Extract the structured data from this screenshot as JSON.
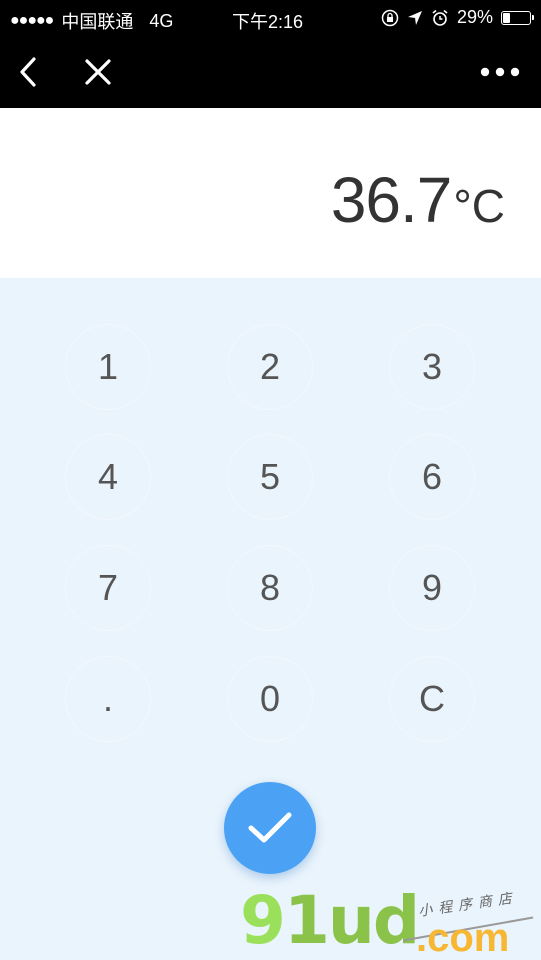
{
  "status_bar": {
    "signal_dots": "●●●●●",
    "carrier": "中国联通",
    "network": "4G",
    "time": "下午2:16",
    "battery_text": "29%",
    "battery_level": 0.29
  },
  "display": {
    "value": "36.7",
    "unit": "°C"
  },
  "keypad": {
    "keys": [
      "1",
      "2",
      "3",
      "4",
      "5",
      "6",
      "7",
      "8",
      "9",
      ".",
      "0",
      "C"
    ]
  },
  "watermark": {
    "brand_a": "9",
    "brand_b": "1ud",
    "domain": ".com",
    "tagline": "小程序商店"
  },
  "colors": {
    "accent": "#4ba2f5",
    "keypad_bg": "#eaf4fc",
    "text": "#333333"
  }
}
